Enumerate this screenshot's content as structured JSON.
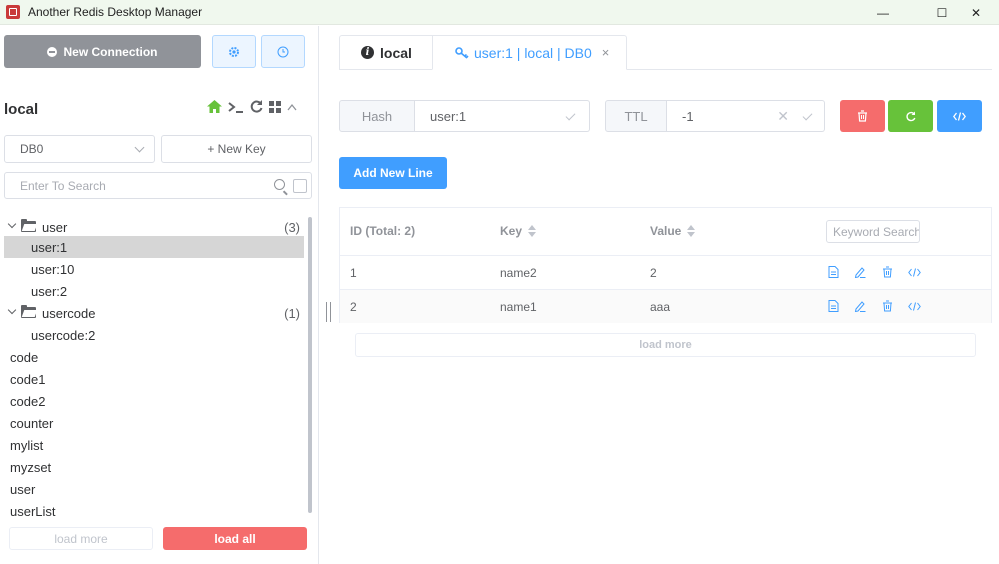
{
  "window": {
    "title": "Another Redis Desktop Manager",
    "minimize": "—",
    "maximize": "☐",
    "close": "✕"
  },
  "sidebar": {
    "new_connection_label": "New Connection",
    "connection_name": "local",
    "db_select": {
      "value": "DB0"
    },
    "new_key_label": "+ New Key",
    "search_placeholder": "Enter To Search",
    "tree": [
      {
        "label": "user",
        "count": "(3)",
        "type": "folder"
      },
      {
        "label": "user:1",
        "type": "key",
        "selected": true
      },
      {
        "label": "user:10",
        "type": "key"
      },
      {
        "label": "user:2",
        "type": "key"
      },
      {
        "label": "usercode",
        "count": "(1)",
        "type": "folder"
      },
      {
        "label": "usercode:2",
        "type": "key"
      },
      {
        "label": "code",
        "type": "root"
      },
      {
        "label": "code1",
        "type": "root"
      },
      {
        "label": "code2",
        "type": "root"
      },
      {
        "label": "counter",
        "type": "root"
      },
      {
        "label": "mylist",
        "type": "root"
      },
      {
        "label": "myzset",
        "type": "root"
      },
      {
        "label": "user",
        "type": "root"
      },
      {
        "label": "userList",
        "type": "root"
      }
    ],
    "load_more_label": "load more",
    "load_all_label": "load all"
  },
  "tabs": {
    "local_label": "local",
    "key_label": "user:1 | local | DB0",
    "close_glyph": "×"
  },
  "key_detail": {
    "type_label": "Hash",
    "key_name": "user:1",
    "ttl_label": "TTL",
    "ttl_value": "-1",
    "add_line_label": "Add New Line"
  },
  "table": {
    "headers": {
      "id": "ID (Total: 2)",
      "key": "Key",
      "value": "Value"
    },
    "keyword_placeholder": "Keyword Search",
    "rows": [
      {
        "id": "1",
        "key": "name2",
        "value": "2"
      },
      {
        "id": "2",
        "key": "name1",
        "value": "aaa"
      }
    ],
    "load_more_label": "load more"
  },
  "colors": {
    "primary": "#409eff",
    "danger": "#f56c6c",
    "success": "#67c23a",
    "info": "#909399"
  }
}
